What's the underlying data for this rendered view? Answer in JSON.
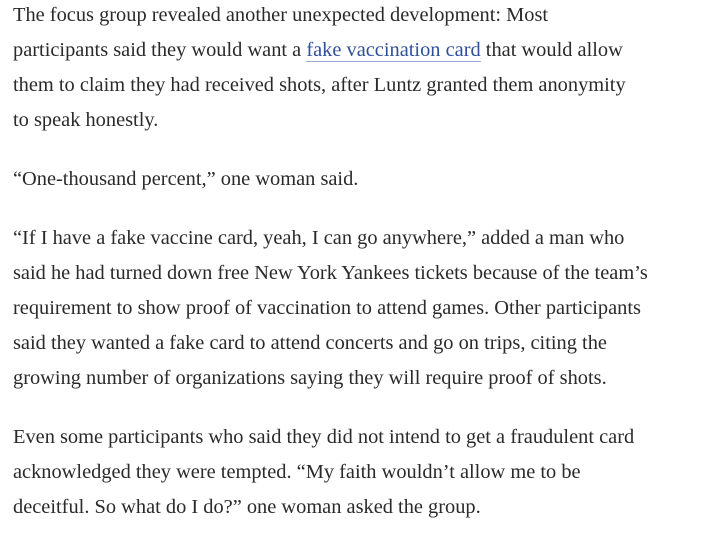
{
  "article": {
    "p1": {
      "l1": "The focus group revealed another unexpected development: Most",
      "l2_pre": "participants said they would want a ",
      "l2_link": "fake vaccination card",
      "l2_post": " that would allow",
      "l3": "them to claim they had received shots, after Luntz granted them anonymity",
      "l4": "to speak honestly."
    },
    "p2": {
      "l1": "“One-thousand percent,” one woman said."
    },
    "p3": {
      "l1": "“If I have a fake vaccine card, yeah, I can go anywhere,” added a man who",
      "l2": "said he had turned down free New York Yankees tickets because of the team’s",
      "l3": "requirement to show proof of vaccination to attend games. Other participants",
      "l4": "said they wanted a fake card to attend concerts and go on trips, citing the",
      "l5": "growing number of organizations saying they will require proof of shots."
    },
    "p4": {
      "l1": "Even some participants who said they did not intend to get a fraudulent card",
      "l2": "acknowledged they were tempted. “My faith wouldn’t allow me to be",
      "l3": "deceitful. So what do I do?” one woman asked the group."
    }
  },
  "colors": {
    "text": "#2a2a2a",
    "link": "#2f4f9a",
    "background": "#ffffff"
  }
}
